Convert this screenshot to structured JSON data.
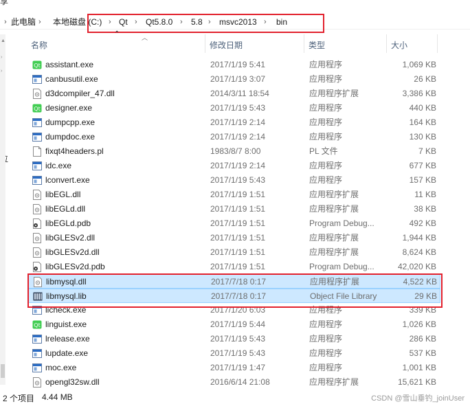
{
  "top_partial_text": "享",
  "left_partial_text": "位",
  "breadcrumb": {
    "items": [
      "此电脑",
      "本地磁盘 (C:)",
      "Qt",
      "Qt5.8.0",
      "5.8",
      "msvc2013",
      "bin"
    ],
    "separator": ">"
  },
  "columns": {
    "name": "名称",
    "date": "修改日期",
    "type": "类型",
    "size": "大小"
  },
  "files": [
    {
      "name": "assistant.exe",
      "date": "2017/1/19 5:41",
      "type": "应用程序",
      "size": "1,069 KB",
      "icon": "qt-app-icon"
    },
    {
      "name": "canbusutil.exe",
      "date": "2017/1/19 3:07",
      "type": "应用程序",
      "size": "26 KB",
      "icon": "exe-icon"
    },
    {
      "name": "d3dcompiler_47.dll",
      "date": "2014/3/11 18:54",
      "type": "应用程序扩展",
      "size": "3,386 KB",
      "icon": "dll-icon"
    },
    {
      "name": "designer.exe",
      "date": "2017/1/19 5:43",
      "type": "应用程序",
      "size": "440 KB",
      "icon": "qt-app-icon"
    },
    {
      "name": "dumpcpp.exe",
      "date": "2017/1/19 2:14",
      "type": "应用程序",
      "size": "164 KB",
      "icon": "exe-icon"
    },
    {
      "name": "dumpdoc.exe",
      "date": "2017/1/19 2:14",
      "type": "应用程序",
      "size": "130 KB",
      "icon": "exe-icon"
    },
    {
      "name": "fixqt4headers.pl",
      "date": "1983/8/7 8:00",
      "type": "PL 文件",
      "size": "7 KB",
      "icon": "file-icon"
    },
    {
      "name": "idc.exe",
      "date": "2017/1/19 2:14",
      "type": "应用程序",
      "size": "677 KB",
      "icon": "exe-icon"
    },
    {
      "name": "lconvert.exe",
      "date": "2017/1/19 5:43",
      "type": "应用程序",
      "size": "157 KB",
      "icon": "exe-icon"
    },
    {
      "name": "libEGL.dll",
      "date": "2017/1/19 1:51",
      "type": "应用程序扩展",
      "size": "11 KB",
      "icon": "dll-icon"
    },
    {
      "name": "libEGLd.dll",
      "date": "2017/1/19 1:51",
      "type": "应用程序扩展",
      "size": "38 KB",
      "icon": "dll-icon"
    },
    {
      "name": "libEGLd.pdb",
      "date": "2017/1/19 1:51",
      "type": "Program Debug...",
      "size": "492 KB",
      "icon": "pdb-icon"
    },
    {
      "name": "libGLESv2.dll",
      "date": "2017/1/19 1:51",
      "type": "应用程序扩展",
      "size": "1,944 KB",
      "icon": "dll-icon"
    },
    {
      "name": "libGLESv2d.dll",
      "date": "2017/1/19 1:51",
      "type": "应用程序扩展",
      "size": "8,624 KB",
      "icon": "dll-icon"
    },
    {
      "name": "libGLESv2d.pdb",
      "date": "2017/1/19 1:51",
      "type": "Program Debug...",
      "size": "42,020 KB",
      "icon": "pdb-icon"
    },
    {
      "name": "libmysql.dll",
      "date": "2017/7/18 0:17",
      "type": "应用程序扩展",
      "size": "4,522 KB",
      "icon": "dll-icon",
      "selected": true
    },
    {
      "name": "libmysql.lib",
      "date": "2017/7/18 0:17",
      "type": "Object File Library",
      "size": "29 KB",
      "icon": "lib-icon",
      "selected": true
    },
    {
      "name": "licheck.exe",
      "date": "2017/1/20 6:03",
      "type": "应用程序",
      "size": "339 KB",
      "icon": "exe-icon"
    },
    {
      "name": "linguist.exe",
      "date": "2017/1/19 5:44",
      "type": "应用程序",
      "size": "1,026 KB",
      "icon": "qt-app-icon"
    },
    {
      "name": "lrelease.exe",
      "date": "2017/1/19 5:43",
      "type": "应用程序",
      "size": "286 KB",
      "icon": "exe-icon"
    },
    {
      "name": "lupdate.exe",
      "date": "2017/1/19 5:43",
      "type": "应用程序",
      "size": "537 KB",
      "icon": "exe-icon"
    },
    {
      "name": "moc.exe",
      "date": "2017/1/19 1:47",
      "type": "应用程序",
      "size": "1,001 KB",
      "icon": "exe-icon"
    },
    {
      "name": "opengl32sw.dll",
      "date": "2016/6/14 21:08",
      "type": "应用程序扩展",
      "size": "15,621 KB",
      "icon": "dll-icon"
    }
  ],
  "status": {
    "count": "2 个项目",
    "size": "4.44 MB"
  },
  "watermark": "CSDN @雪山垂钓_joinUser",
  "colors": {
    "highlight_box": "#e2202c",
    "selection_bg": "#cde8ff",
    "selection_border": "#99d1ff",
    "header_text": "#4c607a",
    "qt_green": "#41cd52",
    "exe_blue": "#2b6cc4"
  }
}
